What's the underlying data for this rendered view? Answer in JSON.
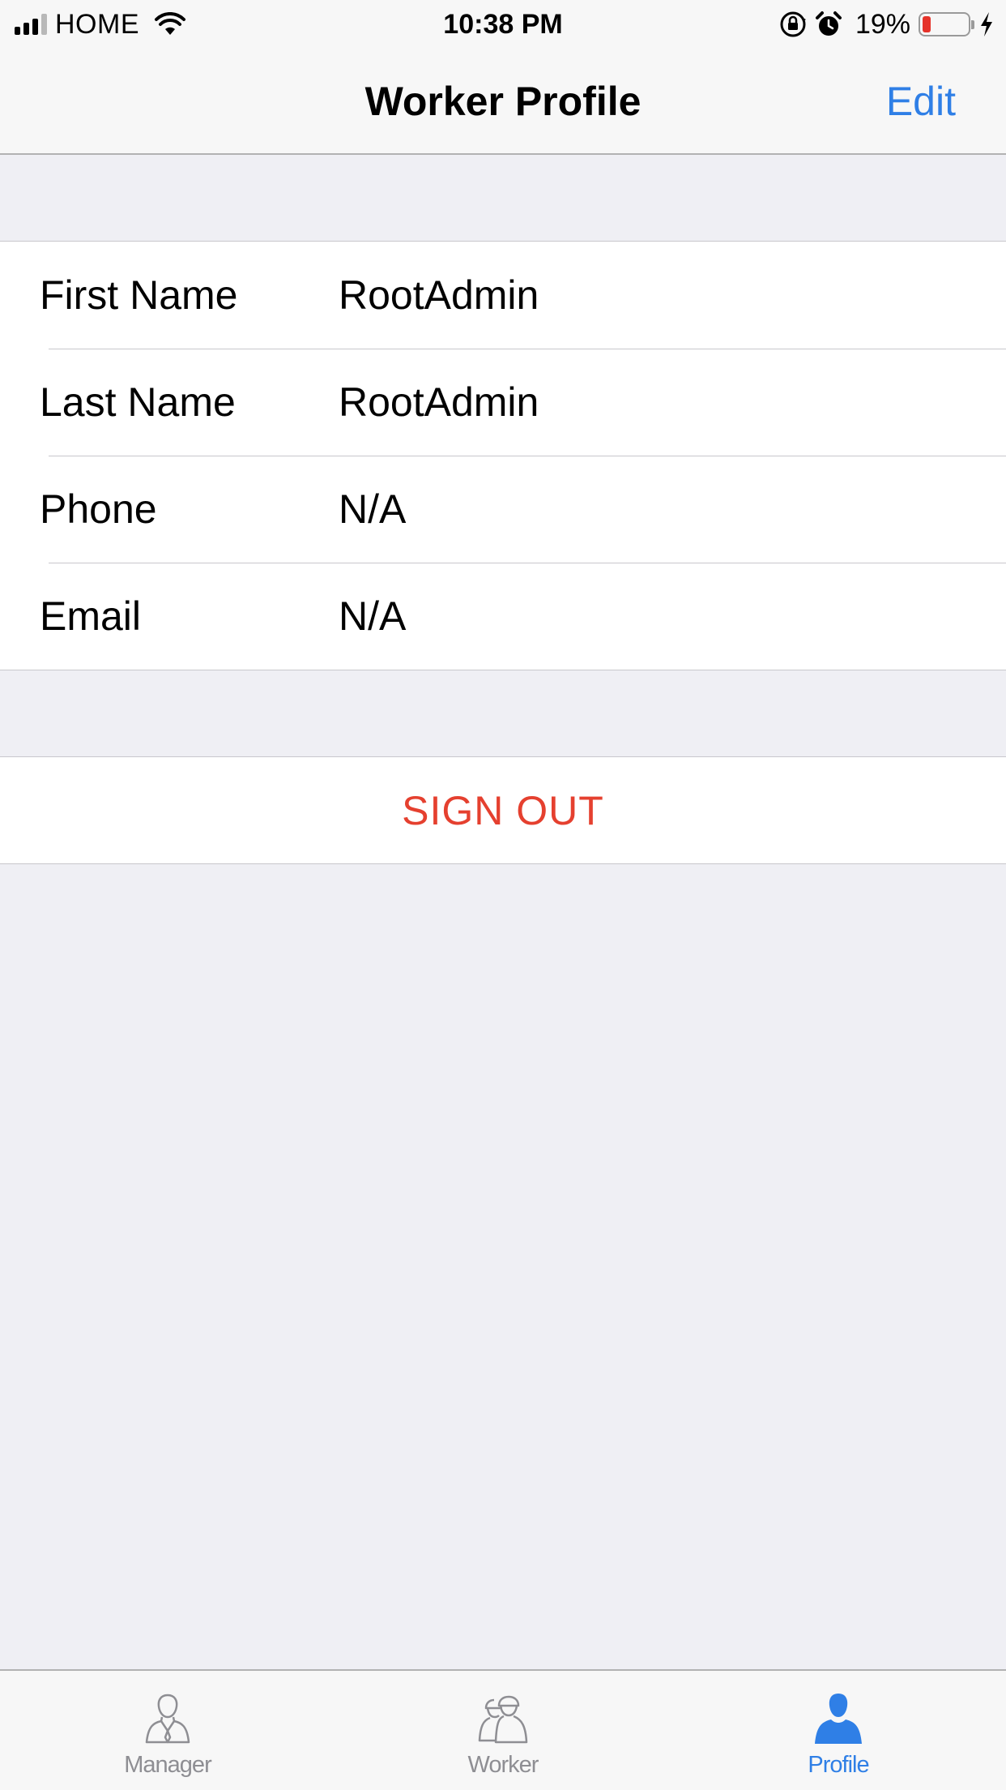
{
  "status_bar": {
    "carrier": "HOME",
    "time": "10:38 PM",
    "battery_percent": "19%",
    "battery_level": 0.19,
    "battery_color": "#e5332a"
  },
  "nav": {
    "title": "Worker Profile",
    "edit_label": "Edit",
    "accent_color": "#2f7fe6"
  },
  "profile": {
    "rows": [
      {
        "label": "First Name",
        "value": "RootAdmin"
      },
      {
        "label": "Last Name",
        "value": "RootAdmin"
      },
      {
        "label": "Phone",
        "value": "N/A"
      },
      {
        "label": "Email",
        "value": "N/A"
      }
    ]
  },
  "sign_out": {
    "label": "SIGN OUT",
    "color": "#e5402f"
  },
  "tab_bar": {
    "tabs": [
      {
        "label": "Manager",
        "icon": "manager-icon",
        "active": false
      },
      {
        "label": "Worker",
        "icon": "worker-icon",
        "active": false
      },
      {
        "label": "Profile",
        "icon": "profile-person-icon",
        "active": true
      }
    ]
  }
}
